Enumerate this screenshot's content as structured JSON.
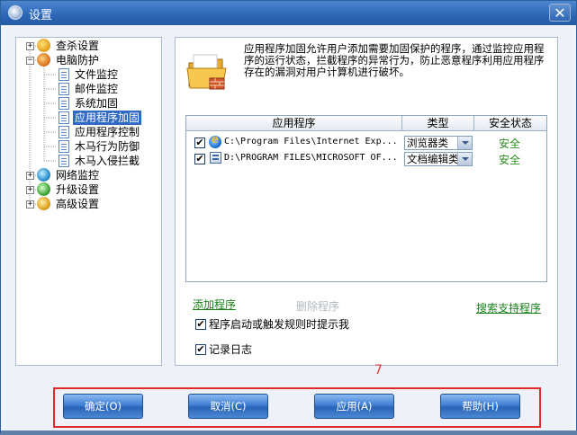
{
  "window": {
    "title": "设置",
    "close_glyph": "✕"
  },
  "tree": {
    "items": [
      {
        "label": "查杀设置",
        "icon": "scan-shield-icon"
      },
      {
        "label": "电脑防护",
        "icon": "defense-hand-icon"
      },
      {
        "label": "文件监控",
        "icon": "document-icon"
      },
      {
        "label": "邮件监控",
        "icon": "document-icon"
      },
      {
        "label": "系统加固",
        "icon": "document-icon"
      },
      {
        "label": "应用程序加固",
        "icon": "document-icon",
        "selected": true
      },
      {
        "label": "应用程序控制",
        "icon": "document-icon"
      },
      {
        "label": "木马行为防御",
        "icon": "document-icon"
      },
      {
        "label": "木马入侵拦截",
        "icon": "document-icon"
      },
      {
        "label": "网络监控",
        "icon": "network-globe-icon"
      },
      {
        "label": "升级设置",
        "icon": "upgrade-globe-icon"
      },
      {
        "label": "高级设置",
        "icon": "advanced-gear-icon"
      }
    ]
  },
  "main": {
    "description": "应用程序加固允许用户添加需要加固保护的程序，通过监控应用程序的运行状态，拦截程序的异常行为，防止恶意程序利用应用程序存在的漏洞对用户计算机进行破坏。",
    "table": {
      "headers": [
        "应用程序",
        "类型",
        "安全状态"
      ],
      "rows": [
        {
          "checked": true,
          "icon": "internet-explorer-icon",
          "path": "C:\\Program Files\\Internet Exp...",
          "type": "浏览器类",
          "status": "安全"
        },
        {
          "checked": true,
          "icon": "office-program-icon",
          "path": "D:\\PROGRAM FILES\\MICROSOFT OF...",
          "type": "文档编辑类",
          "status": "安全"
        }
      ]
    },
    "links": {
      "add": "添加程序",
      "delete": "删除程序",
      "search": "搜索支持程序"
    },
    "options": [
      {
        "checked": true,
        "label": "程序启动或触发规则时提示我"
      },
      {
        "checked": true,
        "label": "记录日志"
      }
    ],
    "check_glyph": "✔"
  },
  "footer": {
    "annotation": "7",
    "buttons": {
      "ok": "确定(O)",
      "cancel": "取消(C)",
      "apply": "应用(A)",
      "help": "帮助(H)"
    }
  },
  "colors": {
    "title_bar": "#2c66b5",
    "selection": "#316ac5",
    "link_green": "#1a7f1a",
    "status_green": "#2b8a1f",
    "annotation_red": "#e02a2a"
  }
}
